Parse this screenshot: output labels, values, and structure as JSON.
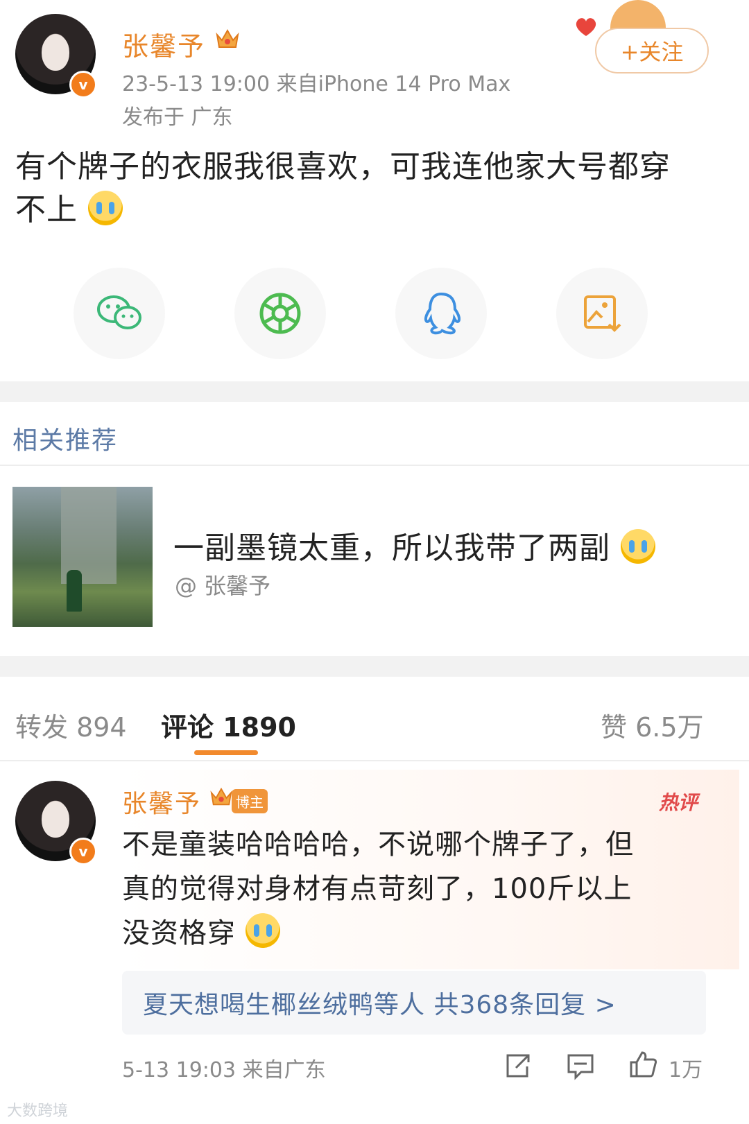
{
  "post": {
    "username": "张馨予",
    "meta_line": "23-5-13 19:00   来自iPhone 14 Pro Max",
    "location_line": "发布于 广东",
    "follow_label": "+关注",
    "text_line1": "有个牌子的衣服我很喜欢，可我连他家大号都穿",
    "text_line2": "不上",
    "share_icons": [
      "wechat-icon",
      "moments-icon",
      "qq-icon",
      "save-image-icon"
    ]
  },
  "recommend": {
    "section_title": "相关推荐",
    "title": "一副墨镜太重，所以我带了两副",
    "author": "@ 张馨予"
  },
  "tabs": {
    "repost_label": "转发 894",
    "comment_label": "评论 1890",
    "like_label": "赞 6.5万"
  },
  "comment": {
    "username": "张馨予",
    "badge": "博主",
    "hot_label": "热评",
    "line1": "不是童装哈哈哈哈，不说哪个牌子了，但",
    "line2": "真的觉得对身材有点苛刻了，100斤以上",
    "line3": "没资格穿",
    "replies_label": "夏天想喝生椰丝绒鸭等人  共368条回复 >",
    "time": "5-13 19:03  来自广东",
    "like_count": "1万"
  },
  "watermark": "大数跨境",
  "colors": {
    "accent_orange": "#e8862a",
    "link_blue": "#4d6e9e",
    "section_blue": "#5c7aa6",
    "hot_red": "#e14a4a"
  }
}
